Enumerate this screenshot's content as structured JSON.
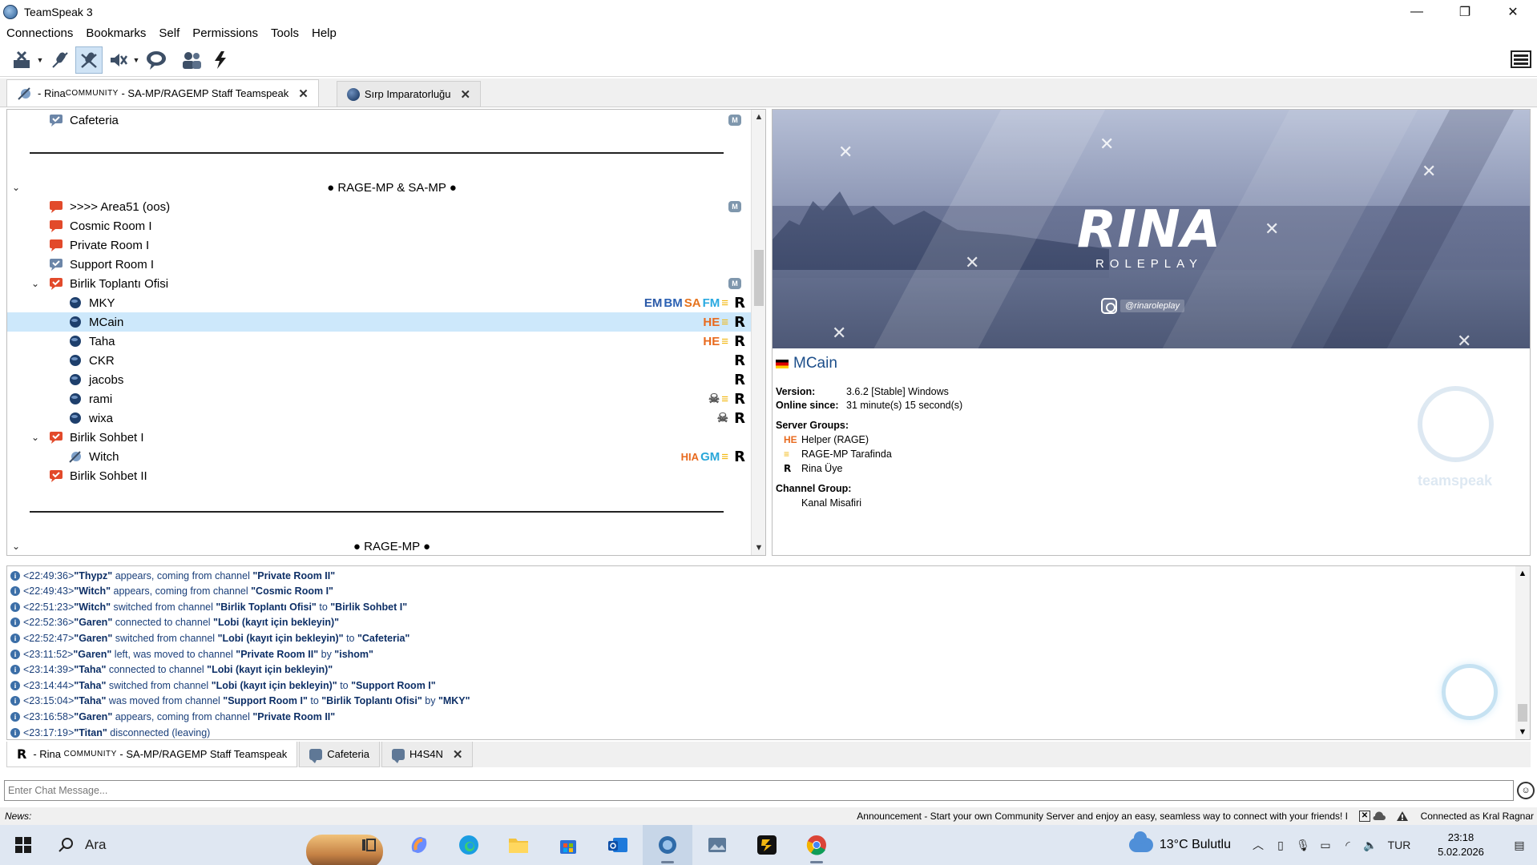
{
  "window": {
    "title": "TeamSpeak 3",
    "controls": [
      "—",
      "❐",
      "✕"
    ]
  },
  "menu": [
    "Connections",
    "Bookmarks",
    "Self",
    "Permissions",
    "Tools",
    "Help"
  ],
  "server_tabs": [
    {
      "label_prefix": "- Rina ",
      "label_caps": "COMMUNITY",
      "label_suffix": " - SA-MP/RAGEMP Staff Teamspeak"
    },
    {
      "label": "Sırp Imparatorluğu"
    }
  ],
  "tree": {
    "top_channel": "Cafeteria",
    "spacer1": "——————————————————————————————————————————————",
    "section1": "● RAGE-MP & SA-MP ●",
    "channels": [
      {
        "name": ">>>> Area51 (oos)"
      },
      {
        "name": "Cosmic Room I"
      },
      {
        "name": "Private Room I"
      },
      {
        "name": "Support Room I"
      },
      {
        "name": "Birlik Toplantı Ofisi"
      }
    ],
    "clients_birlik": [
      {
        "name": "MKY",
        "badges": [
          "EM",
          "BM",
          "SA",
          "FM"
        ]
      },
      {
        "name": "MCain",
        "badges": [
          "HE"
        ]
      },
      {
        "name": "Taha",
        "badges": [
          "HE"
        ]
      },
      {
        "name": "CKR",
        "badges": []
      },
      {
        "name": "jacobs",
        "badges": []
      },
      {
        "name": "rami",
        "badges": []
      },
      {
        "name": "wixa",
        "badges": []
      }
    ],
    "sohbet1": "Birlik Sohbet I",
    "witch": {
      "name": "Witch",
      "badges": [
        "HIA",
        "GM"
      ]
    },
    "sohbet2": "Birlik Sohbet II",
    "section2": "● RAGE-MP ●",
    "m_badge": "M",
    "r_badge": "R"
  },
  "info": {
    "banner": {
      "logo": "RINA",
      "sub": "ROLEPLAY",
      "handle": "@rinaroleplay"
    },
    "client_name": "MCain",
    "version_label": "Version:",
    "version_value": "3.6.2 [Stable] Windows",
    "online_label": "Online since:",
    "online_value": "31 minute(s) 15 second(s)",
    "server_groups_label": "Server Groups:",
    "server_groups": [
      {
        "icon": "HE",
        "name": "Helper (RAGE)"
      },
      {
        "icon": "≡",
        "name": "RAGE-MP Tarafinda"
      },
      {
        "icon": "R",
        "name": "Rina Üye"
      }
    ],
    "channel_group_label": "Channel Group:",
    "channel_group": "Kanal Misafiri",
    "watermark": "teamspeak"
  },
  "log": [
    {
      "time": "<22:49:36>",
      "parts": [
        [
          "b",
          "\"Thypz\""
        ],
        [
          "t",
          " appears, coming from channel "
        ],
        [
          "b",
          "\"Private Room II\""
        ]
      ]
    },
    {
      "time": "<22:49:43>",
      "parts": [
        [
          "b",
          "\"Witch\""
        ],
        [
          "t",
          " appears, coming from channel "
        ],
        [
          "b",
          "\"Cosmic Room I\""
        ]
      ]
    },
    {
      "time": "<22:51:23>",
      "parts": [
        [
          "b",
          "\"Witch\""
        ],
        [
          "t",
          " switched from channel "
        ],
        [
          "b",
          "\"Birlik Toplantı Ofisi\""
        ],
        [
          "t",
          " to "
        ],
        [
          "b",
          "\"Birlik Sohbet I\""
        ]
      ]
    },
    {
      "time": "<22:52:36>",
      "parts": [
        [
          "b",
          "\"Garen\""
        ],
        [
          "t",
          " connected to channel "
        ],
        [
          "b",
          "\"Lobi (kayıt için bekleyin)\""
        ]
      ]
    },
    {
      "time": "<22:52:47>",
      "parts": [
        [
          "b",
          "\"Garen\""
        ],
        [
          "t",
          " switched from channel "
        ],
        [
          "b",
          "\"Lobi (kayıt için bekleyin)\""
        ],
        [
          "t",
          " to "
        ],
        [
          "b",
          "\"Cafeteria\""
        ]
      ]
    },
    {
      "time": "<23:11:52>",
      "parts": [
        [
          "b",
          "\"Garen\""
        ],
        [
          "t",
          " left, was moved to channel "
        ],
        [
          "b",
          "\"Private Room II\""
        ],
        [
          "t",
          " by "
        ],
        [
          "b",
          "\"ishom\""
        ]
      ]
    },
    {
      "time": "<23:14:39>",
      "parts": [
        [
          "b",
          "\"Taha\""
        ],
        [
          "t",
          " connected to channel "
        ],
        [
          "b",
          "\"Lobi (kayıt için bekleyin)\""
        ]
      ]
    },
    {
      "time": "<23:14:44>",
      "parts": [
        [
          "b",
          "\"Taha\""
        ],
        [
          "t",
          " switched from channel "
        ],
        [
          "b",
          "\"Lobi (kayıt için bekleyin)\""
        ],
        [
          "t",
          " to "
        ],
        [
          "b",
          "\"Support Room I\""
        ]
      ]
    },
    {
      "time": "<23:15:04>",
      "parts": [
        [
          "b",
          "\"Taha\""
        ],
        [
          "t",
          " was moved from channel "
        ],
        [
          "b",
          "\"Support Room I\""
        ],
        [
          "t",
          " to "
        ],
        [
          "b",
          "\"Birlik Toplantı Ofisi\""
        ],
        [
          "t",
          " by "
        ],
        [
          "b",
          "\"MKY\""
        ]
      ]
    },
    {
      "time": "<23:16:58>",
      "parts": [
        [
          "b",
          "\"Garen\""
        ],
        [
          "t",
          " appears, coming from channel "
        ],
        [
          "b",
          "\"Private Room II\""
        ]
      ]
    },
    {
      "time": "<23:17:19>",
      "parts": [
        [
          "b",
          "\"Titan\""
        ],
        [
          "t",
          " disconnected (leaving)"
        ]
      ]
    }
  ],
  "chat_tabs": [
    {
      "icon": "R",
      "label_prefix": "- Rina ",
      "label_caps": "COMMUNITY",
      "label_suffix": " - SA-MP/RAGEMP Staff Teamspeak"
    },
    {
      "label": "Cafeteria"
    },
    {
      "label": "H4S4N"
    }
  ],
  "chat_input": {
    "placeholder": "Enter Chat Message..."
  },
  "news": {
    "label": "News:",
    "text": "Announcement - Start your own Community Server and enjoy an easy, seamless way to connect with your friends! I",
    "status": "Connected as Kral Ragnar"
  },
  "taskbar": {
    "search": "Ara",
    "weather": "13°C Bulutlu",
    "lang": "TUR",
    "time": "23:18",
    "date": "5.02.2026"
  },
  "colors": {
    "accent": "#1c4e8a",
    "selection": "#cde8fb",
    "log_bold": "#0d2f66"
  }
}
